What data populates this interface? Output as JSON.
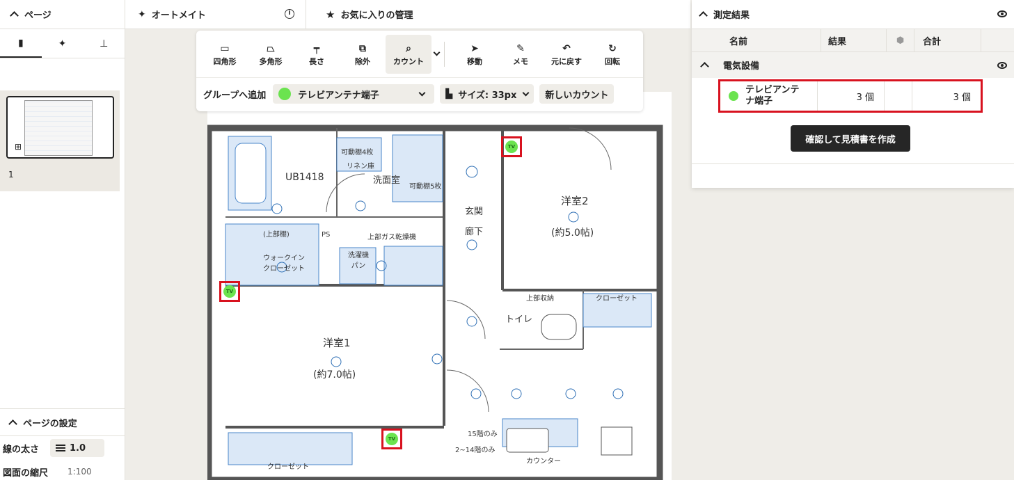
{
  "header": {
    "pages_label": "ページ",
    "automate_label": "オートメイト",
    "favorites_label": "お気に入りの管理",
    "results_label": "測定結果"
  },
  "left_panel": {
    "thumbnail_page_number": "1",
    "settings": {
      "title": "ページの設定",
      "line_width_label": "線の太さ",
      "line_width_value": "1.0",
      "scale_label": "図面の縮尺",
      "scale_value": "1:100"
    }
  },
  "toolbar": {
    "tools": [
      {
        "label": "四角形",
        "icon": "rectangle-icon"
      },
      {
        "label": "多角形",
        "icon": "polygon-icon"
      },
      {
        "label": "長さ",
        "icon": "ruler-icon"
      },
      {
        "label": "除外",
        "icon": "exclude-icon"
      },
      {
        "label": "カウント",
        "icon": "count-icon",
        "active": true
      },
      {
        "label": "移動",
        "icon": "cursor-icon"
      },
      {
        "label": "メモ",
        "icon": "pen-icon"
      },
      {
        "label": "元に戻す",
        "icon": "undo-icon"
      },
      {
        "label": "回転",
        "icon": "rotate-icon"
      }
    ],
    "add_to_group_label": "グループへ追加",
    "selected_item": "テレビアンテナ端子",
    "size_label": "サイズ: 33px",
    "new_count_label": "新しいカウント",
    "accent_color": "#6be34f"
  },
  "results": {
    "columns": [
      "名前",
      "結果",
      "合計"
    ],
    "group_name": "電気設備",
    "rows": [
      {
        "name": "テレビアンテナ端子",
        "result": "3 個",
        "total": "3 個"
      }
    ],
    "cta_label": "確認して見積書を作成"
  },
  "floorplan": {
    "labels": {
      "ub": "UB1418",
      "washroom": "洗面室",
      "entrance": "玄関",
      "room2": "洋室2",
      "room2_size": "(約5.0帖)",
      "hall": "廊下",
      "toilet": "トイレ",
      "room1": "洋室1",
      "room1_size": "(約7.0帖)",
      "closet1": "クローゼット",
      "walkin": "ウォークイン\nクローゼット",
      "upper_shelf": "(上部棚)",
      "shelf4": "可動棚4枚",
      "linen": "リネン庫",
      "ps": "PS",
      "gas_dryer": "上部ガス乾燥機",
      "washer_pan": "洗濯機\nパン",
      "shelf5": "可動棚5枚",
      "closet2": "クローゼット",
      "counter": "カウンター",
      "floor15": "15階のみ",
      "floor2_14": "2~14階のみ",
      "upper_storage": "上部収納",
      "shelf_mark": "棚"
    },
    "tv_marker_text": "TV"
  }
}
